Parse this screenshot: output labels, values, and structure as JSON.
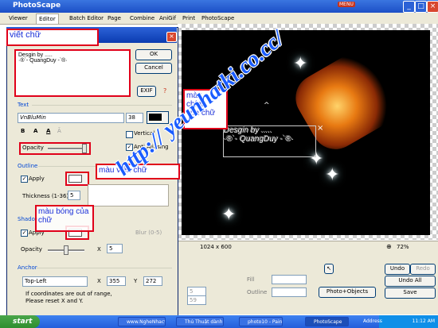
{
  "app": {
    "title": "PhotoScape",
    "menu_label": "MENU"
  },
  "tabs": [
    "Viewer",
    "Editor",
    "Batch Editor",
    "Page",
    "Combine",
    "AniGif",
    "Print",
    "PhotoScape"
  ],
  "canvas": {
    "text_line1": "Desgin by .....",
    "text_line2": "·®`- QuangDuy -`®·",
    "size_label": "1024 x 600",
    "zoom": "72%"
  },
  "dialog": {
    "annot_title": "viết chữ",
    "text_content_line1": "Desgin by .....",
    "text_content_line2": "·®`- QuangDuy -`®·",
    "ok": "OK",
    "cancel": "Cancel",
    "exif": "EXIF",
    "section_text": "Text",
    "font_name": "VnBluMin",
    "font_size": "38",
    "font_color": "#000000",
    "style_buttons": [
      "B",
      "A",
      "A",
      "Ā"
    ],
    "vertical": "Vertical",
    "opacity": "Opacity",
    "anti_aliasing": "Anti Aliasing",
    "section_outline": "Outline",
    "apply": "Apply",
    "thickness": "Thickness (1-36)",
    "thickness_value": "5",
    "section_shadow": "Shadow",
    "shadow_apply": "Apply",
    "blur": "Blur (0-5)",
    "shadow_opacity": "Opacity",
    "x_label": "X",
    "x_value": "5",
    "section_anchor": "Anchor",
    "anchor_value": "Top-Left",
    "anchor_x_label": "X",
    "anchor_x": "355",
    "anchor_y_label": "Y",
    "anchor_y": "272",
    "note": "If coordinates are out of range, Please reset X and Y."
  },
  "annotations": {
    "main_color": "màu\nchính\ncủa chữ",
    "outline_color": "màu viền chữ",
    "shadow_color": "màu bóng của\nchữ"
  },
  "bottom": {
    "fill": "Fill",
    "outline": "Outline",
    "photo_objects": "Photo+Objects",
    "undo": "Undo",
    "redo": "Redo",
    "undo_all": "Undo All",
    "save": "Save",
    "value_5": "5",
    "value_59": "59"
  },
  "watermark": "http:// yeunhatki.co.cc/",
  "taskbar": {
    "start": "start",
    "tasks": [
      "www.NgheNhac9v...",
      "Thủ Thuật dành ch...",
      "photo10 - Paint",
      "PhotoScape"
    ],
    "address": "Address",
    "clock": "11:12 AM"
  }
}
